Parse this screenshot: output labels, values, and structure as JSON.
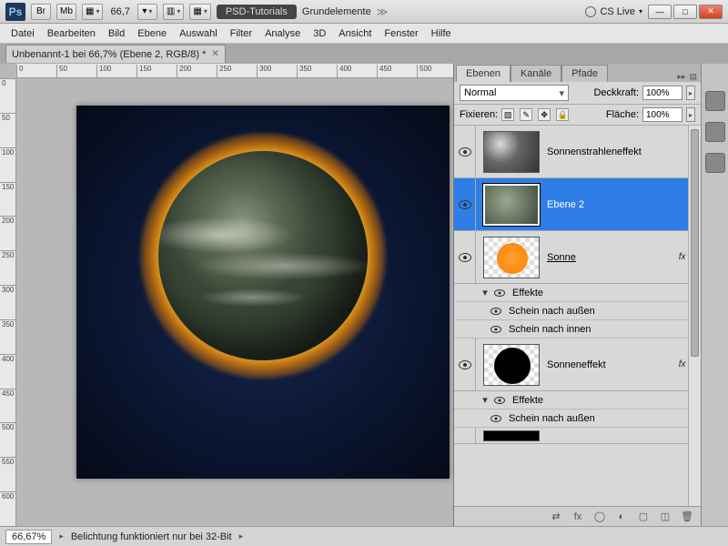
{
  "topbar": {
    "ps": "Ps",
    "br": "Br",
    "mb": "Mb",
    "zoom": "66,7",
    "workspace_active": "PSD-Tutorials",
    "workspace_other": "Grundelemente",
    "cslive": "CS Live"
  },
  "menu": [
    "Datei",
    "Bearbeiten",
    "Bild",
    "Ebene",
    "Auswahl",
    "Filter",
    "Analyse",
    "3D",
    "Ansicht",
    "Fenster",
    "Hilfe"
  ],
  "doc_tab": {
    "title": "Unbenannt-1 bei 66,7% (Ebene 2, RGB/8) *"
  },
  "ruler_h": [
    "0",
    "50",
    "100",
    "150",
    "200",
    "250",
    "300",
    "350",
    "400",
    "450",
    "500"
  ],
  "ruler_v": [
    "0",
    "50",
    "100",
    "150",
    "200",
    "250",
    "300",
    "350",
    "400",
    "450",
    "500",
    "550",
    "600"
  ],
  "panel": {
    "tabs": [
      "Ebenen",
      "Kanäle",
      "Pfade"
    ],
    "blend_mode": "Normal",
    "opacity_label": "Deckkraft:",
    "opacity_value": "100%",
    "lock_label": "Fixieren:",
    "fill_label": "Fläche:",
    "fill_value": "100%"
  },
  "layers": [
    {
      "name": "Sonnenstrahleneffekt",
      "thumb": "clouds"
    },
    {
      "name": "Ebene 2",
      "thumb": "green",
      "selected": true
    },
    {
      "name": "Sonne",
      "thumb": "sun",
      "fx": true,
      "link": true,
      "effects": {
        "head": "Effekte",
        "items": [
          "Schein nach außen",
          "Schein nach innen"
        ]
      }
    },
    {
      "name": "Sonneneffekt",
      "thumb": "black",
      "fx": true,
      "effects": {
        "head": "Effekte",
        "items": [
          "Schein nach außen"
        ]
      }
    },
    {
      "name": "",
      "thumb": "solid-black",
      "partial": true
    }
  ],
  "status": {
    "zoom": "66,67%",
    "msg": "Belichtung funktioniert nur bei 32-Bit"
  }
}
